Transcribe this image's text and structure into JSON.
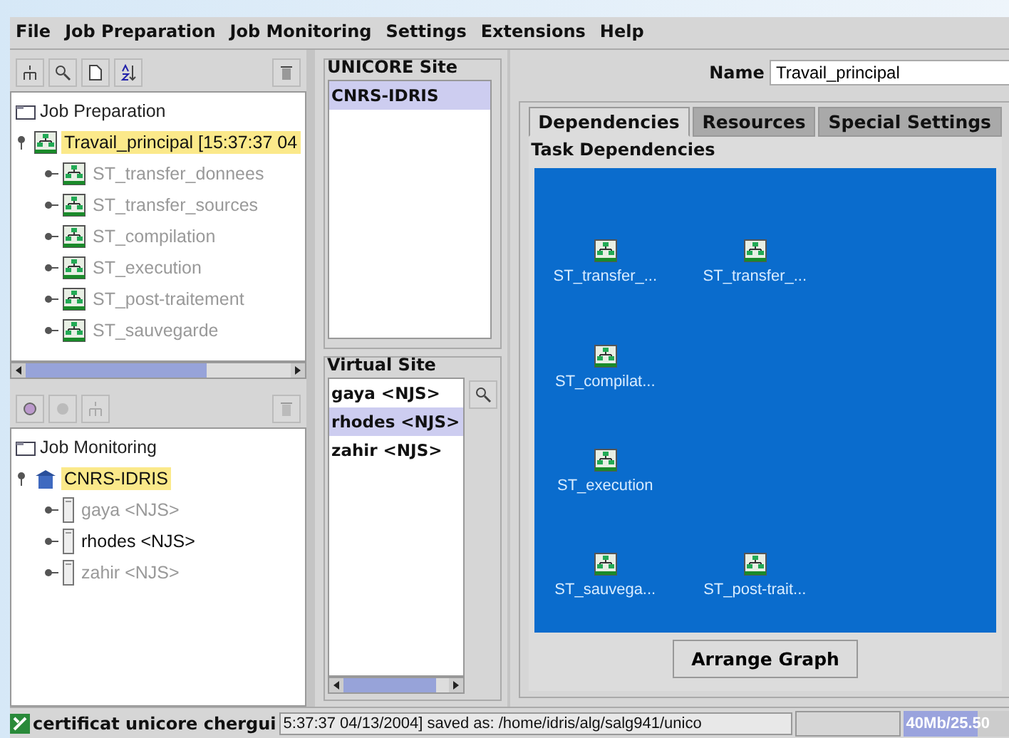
{
  "menu": [
    "File",
    "Job Preparation",
    "Job Monitoring",
    "Settings",
    "Extensions",
    "Help"
  ],
  "job_preparation": {
    "root": "Job Preparation",
    "tree": [
      {
        "label": "Travail_principal [15:37:37 04",
        "selected": true,
        "disabled": false,
        "expanded": true,
        "children": [
          {
            "label": "ST_transfer_donnees",
            "selected": false,
            "disabled": true,
            "expanded": false
          },
          {
            "label": "ST_transfer_sources",
            "selected": false,
            "disabled": true,
            "expanded": false
          },
          {
            "label": "ST_compilation",
            "selected": false,
            "disabled": true,
            "expanded": false
          },
          {
            "label": "ST_execution",
            "selected": false,
            "disabled": true,
            "expanded": false
          },
          {
            "label": "ST_post-traitement",
            "selected": false,
            "disabled": true,
            "expanded": false
          },
          {
            "label": "ST_sauvegarde",
            "selected": false,
            "disabled": true,
            "expanded": false
          }
        ]
      }
    ]
  },
  "job_monitoring": {
    "root": "Job Monitoring",
    "tree": [
      {
        "label": "CNRS-IDRIS",
        "selected": true,
        "disabled": false,
        "expanded": true,
        "children": [
          {
            "label": "gaya <NJS>",
            "selected": false,
            "disabled": true,
            "expanded": false
          },
          {
            "label": "rhodes <NJS>",
            "selected": false,
            "disabled": false,
            "expanded": false
          },
          {
            "label": "zahir <NJS>",
            "selected": false,
            "disabled": true,
            "expanded": false
          }
        ]
      }
    ]
  },
  "unicore_site": {
    "title": "UNICORE Site",
    "items": [
      {
        "label": "CNRS-IDRIS",
        "selected": true
      }
    ]
  },
  "virtual_site": {
    "title": "Virtual Site",
    "items": [
      {
        "label": "gaya <NJS>",
        "selected": false
      },
      {
        "label": "rhodes <NJS>",
        "selected": true
      },
      {
        "label": "zahir <NJS>",
        "selected": false
      }
    ]
  },
  "name_field": {
    "label": "Name",
    "value": "Travail_principal"
  },
  "tabs": [
    {
      "label": "Dependencies",
      "selected": true
    },
    {
      "label": "Resources",
      "selected": false
    },
    {
      "label": "Special Settings",
      "selected": false
    }
  ],
  "task_dependencies": {
    "title": "Task Dependencies",
    "nodes": [
      "ST_transfer_...",
      "ST_transfer_...",
      "ST_compilat...",
      "ST_execution",
      "ST_sauvega...",
      "ST_post-trait..."
    ]
  },
  "arrange_button": "Arrange Graph",
  "status_bar": {
    "certificate": "certificat unicore chergui",
    "message": "5:37:37 04/13/2004] saved as: /home/idris/alg/salg941/unico",
    "memory": "40Mb/25.50",
    "level": 0.7
  }
}
